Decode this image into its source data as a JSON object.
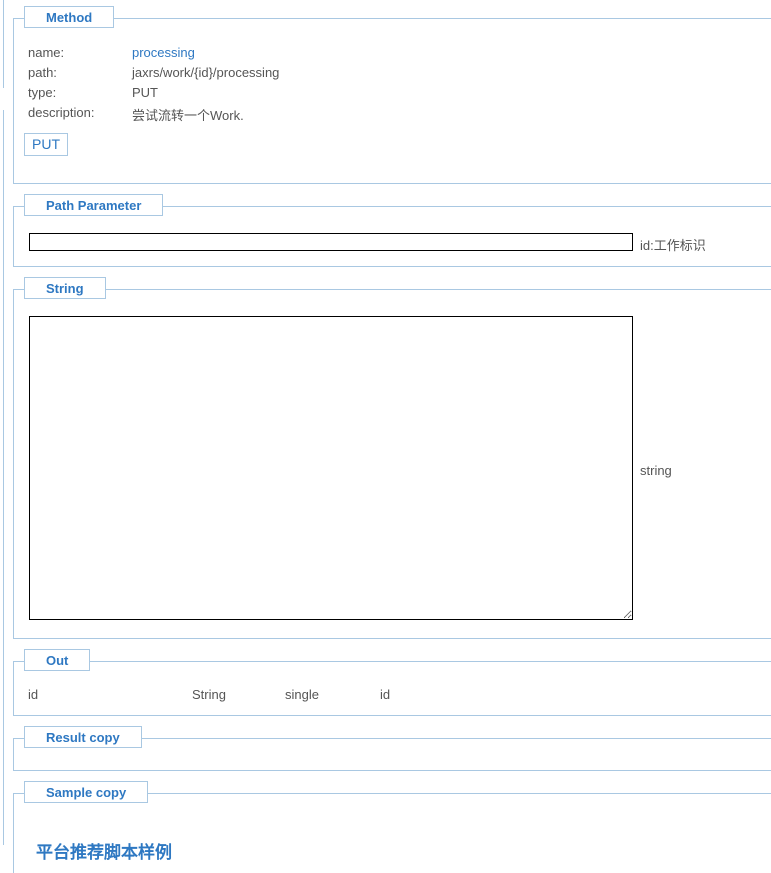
{
  "method": {
    "legend": "Method",
    "name_label": "name:",
    "name_value": "processing",
    "path_label": "path:",
    "path_value": "jaxrs/work/{id}/processing",
    "type_label": "type:",
    "type_value": "PUT",
    "description_label": "description:",
    "description_value": "尝试流转一个Work.",
    "submit_label": "PUT"
  },
  "path_parameter": {
    "legend": "Path Parameter",
    "id_value": "",
    "id_note": "id:工作标识"
  },
  "string_section": {
    "legend": "String",
    "body_value": "",
    "note": "string"
  },
  "out": {
    "legend": "Out",
    "columns": [
      "id",
      "String",
      "single",
      "id"
    ]
  },
  "result_copy": {
    "legend": "Result copy"
  },
  "sample_copy": {
    "legend": "Sample copy",
    "heading": "平台推荐脚本样例"
  },
  "colors": {
    "accent": "#2e78c2",
    "border": "#a9c8e2",
    "text": "#555555"
  }
}
